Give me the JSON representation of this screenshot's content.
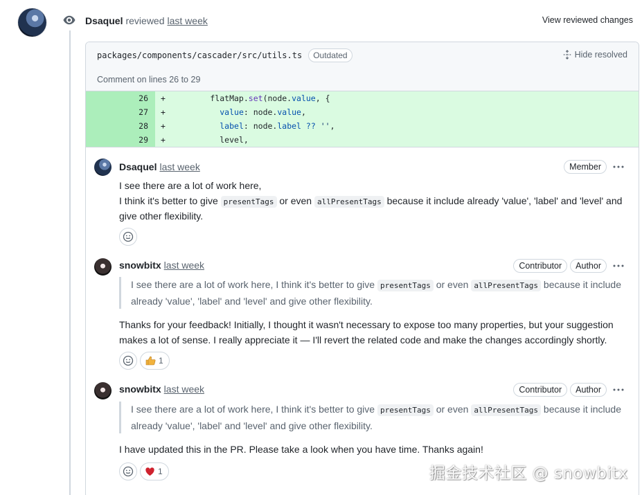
{
  "review": {
    "author": "Dsaquel",
    "action": "reviewed",
    "time": "last week",
    "view_reviewed_label": "View reviewed changes"
  },
  "thread": {
    "file_path": "packages/components/cascader/src/utils.ts",
    "outdated_label": "Outdated",
    "hide_resolved_label": "Hide resolved",
    "comment_lines_label": "Comment on lines 26 to 29",
    "code_lines": [
      {
        "num": "26",
        "sign": "+",
        "text": "        flatMap.set(node.value, {"
      },
      {
        "num": "27",
        "sign": "+",
        "text": "          value: node.value,"
      },
      {
        "num": "28",
        "sign": "+",
        "text": "          label: node.label ?? '',"
      },
      {
        "num": "29",
        "sign": "+",
        "text": "          level,"
      }
    ]
  },
  "comments": [
    {
      "author": "Dsaquel",
      "time": "last week",
      "badges": [
        "Member"
      ],
      "line1": "I see there are a lot of work here,",
      "line2_a": "I think it's better to give",
      "code1": "presentTags",
      "line2_b": "or even",
      "code2": "allPresentTags",
      "line2_c": "because it include already 'value', 'label' and 'level' and give other flexibility."
    },
    {
      "author": "snowbitx",
      "time": "last week",
      "badges": [
        "Contributor",
        "Author"
      ],
      "quote_a": "I see there are a lot of work here, I think it's better to give",
      "quote_code1": "presentTags",
      "quote_b": "or even",
      "quote_code2": "allPresentTags",
      "quote_c": "because it include already 'value', 'label' and 'level' and give other flexibility.",
      "body": "Thanks for your feedback! Initially, I thought it wasn't necessary to expose too many properties, but your suggestion makes a lot of sense. I really appreciate it — I'll revert the related code and make the changes accordingly shortly.",
      "reaction": {
        "emoji": "thumbs-up",
        "count": "1"
      }
    },
    {
      "author": "snowbitx",
      "time": "last week",
      "badges": [
        "Contributor",
        "Author"
      ],
      "quote_a": "I see there are a lot of work here, I think it's better to give",
      "quote_code1": "presentTags",
      "quote_b": "or even",
      "quote_code2": "allPresentTags",
      "quote_c": "because it include already 'value', 'label' and 'level' and give other flexibility.",
      "body": "I have updated this in the PR. Please take a look when you have time. Thanks again!",
      "reaction": {
        "emoji": "heart",
        "count": "1"
      }
    }
  ],
  "watermark": "掘金技术社区 @ snowbitx",
  "colors": {
    "added_line_num_bg": "#aceebb",
    "added_line_bg": "#dafbe1",
    "border": "#d0d7de",
    "muted_text": "#59636e",
    "heart": "#cf222e",
    "thumbs": "#f2b33d"
  }
}
